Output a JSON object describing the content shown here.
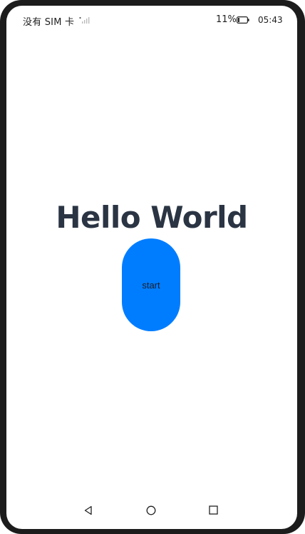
{
  "status_bar": {
    "carrier": "没有 SIM 卡",
    "signal_icon": "signal-no-sim-icon",
    "battery_percent": "11%",
    "battery_icon": "battery-low-icon",
    "time": "05:43"
  },
  "main": {
    "title": "Hello World",
    "start_button_label": "start"
  },
  "nav_bar": {
    "back_icon": "back-triangle-icon",
    "home_icon": "home-circle-icon",
    "recent_icon": "recent-square-icon"
  },
  "colors": {
    "button": "#007dff",
    "title": "#2a3443",
    "frame": "#1c1c1c"
  }
}
